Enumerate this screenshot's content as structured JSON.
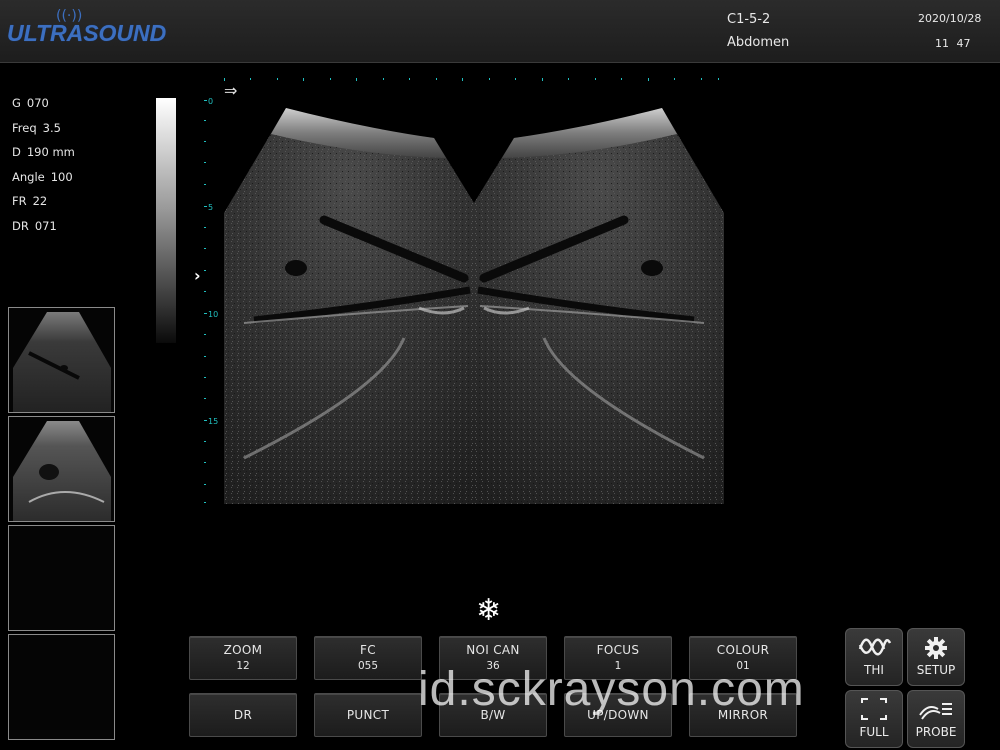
{
  "header": {
    "logo": "ULTRASOUND",
    "probe": "C1-5-2",
    "preset": "Abdomen",
    "date": "2020/10/28",
    "time": "11 47"
  },
  "params": [
    {
      "label": "G",
      "value": "070"
    },
    {
      "label": "Freq",
      "value": "3.5"
    },
    {
      "label": "D",
      "value": "190 mm"
    },
    {
      "label": "Angle",
      "value": "100"
    },
    {
      "label": "FR",
      "value": "22"
    },
    {
      "label": "DR",
      "value": "071"
    }
  ],
  "depth_labels": [
    "0",
    "5",
    "10",
    "15"
  ],
  "buttons_row1": [
    {
      "label": "ZOOM",
      "value": "12"
    },
    {
      "label": "FC",
      "value": "055"
    },
    {
      "label": "NOI CAN",
      "value": "36"
    },
    {
      "label": "FOCUS",
      "value": "1"
    },
    {
      "label": "COLOUR",
      "value": "01"
    }
  ],
  "buttons_row2": [
    {
      "label": "DR"
    },
    {
      "label": "PUNCT"
    },
    {
      "label": "B/W"
    },
    {
      "label": "UP/DOWN"
    },
    {
      "label": "MIRROR"
    }
  ],
  "side_buttons": [
    {
      "label": "THI",
      "icon": "thi-wave-icon"
    },
    {
      "label": "SETUP",
      "icon": "gear-icon"
    },
    {
      "label": "FULL",
      "icon": "fullscreen-icon"
    },
    {
      "label": "PROBE",
      "icon": "probe-icon"
    }
  ],
  "watermark": "id.sckrayson.com",
  "colors": {
    "logo": "#3c6fc0",
    "depth_scale": "#20c0c0",
    "background": "#000000"
  }
}
